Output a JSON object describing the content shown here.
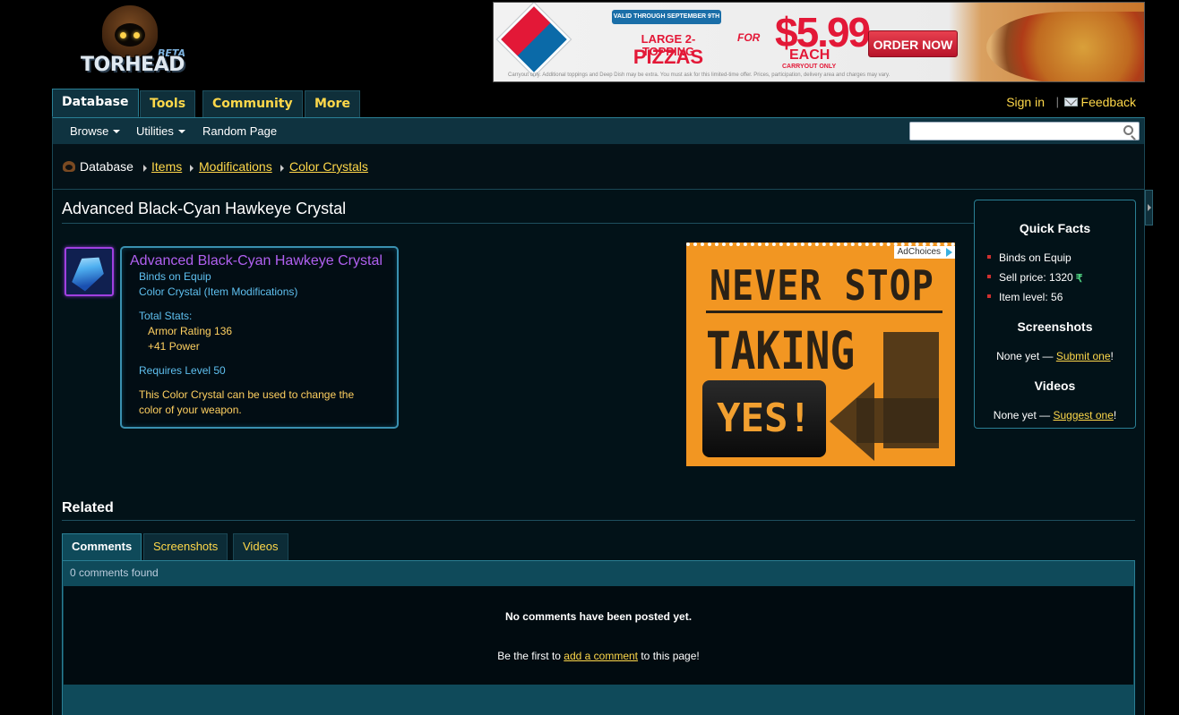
{
  "logo": {
    "text": "TORHEAD",
    "badge": "BETA"
  },
  "top_ad": {
    "brand": "Domino's Pizza",
    "banner": "VALID THROUGH SEPTEMBER 9TH",
    "line1": "LARGE 2-TOPPING",
    "line2": "PIZZAS",
    "for": "FOR",
    "price": "$5.99",
    "each": "EACH",
    "carryout": "CARRYOUT ONLY",
    "cta": "ORDER NOW",
    "fine_print": "Carryout only. Additional toppings and Deep Dish may be extra. You must ask for this limited-time offer. Prices, participation, delivery area and charges may vary."
  },
  "nav": {
    "tabs": [
      {
        "label": "Database",
        "active": true
      },
      {
        "label": "Tools",
        "active": false
      },
      {
        "label": "Community",
        "active": false
      },
      {
        "label": "More",
        "active": false
      }
    ],
    "sign_in": "Sign in",
    "separator": "|",
    "feedback": "Feedback"
  },
  "subnav": {
    "browse": "Browse",
    "utilities": "Utilities",
    "random_page": "Random Page",
    "search_placeholder": ""
  },
  "breadcrumb": [
    "Database",
    "Items",
    "Modifications",
    "Color Crystals"
  ],
  "page_title": "Advanced Black-Cyan Hawkeye Crystal",
  "tooltip": {
    "name": "Advanced Black-Cyan Hawkeye Crystal",
    "binds": "Binds on Equip",
    "type": "Color Crystal (Item Modifications)",
    "total_stats_label": "Total Stats:",
    "stats": [
      "Armor Rating 136",
      "+41 Power"
    ],
    "requires": "Requires Level 50",
    "description_line1": "This Color Crystal can be used to change the",
    "description_line2": "color of your weapon."
  },
  "side_ad": {
    "adchoices": "AdChoices",
    "line1": "NEVER STOP",
    "line2": "TAKING",
    "button": "YES!"
  },
  "quick_facts": {
    "title": "Quick Facts",
    "items": [
      "Binds on Equip",
      "Sell price: 1320",
      "Item level: 56"
    ],
    "screenshots_title": "Screenshots",
    "screenshots_prefix": "None yet — ",
    "screenshots_link": "Submit one",
    "screenshots_suffix": "!",
    "videos_title": "Videos",
    "videos_prefix": "None yet — ",
    "videos_link": "Suggest one",
    "videos_suffix": "!"
  },
  "related": {
    "title": "Related",
    "tabs": [
      {
        "label": "Comments",
        "active": true
      },
      {
        "label": "Screenshots",
        "active": false
      },
      {
        "label": "Videos",
        "active": false
      }
    ],
    "count_text": "0 comments found",
    "no_comments": "No comments have been posted yet.",
    "be_first_prefix": "Be the first to ",
    "be_first_link": "add a comment",
    "be_first_suffix": " to this page!"
  },
  "colors": {
    "accent_gold": "#ffd84a",
    "panel_teal": "#0f3340",
    "border_teal": "#2a7f94",
    "item_purple": "#b060f0",
    "tooltip_blue": "#5fc0f0"
  }
}
